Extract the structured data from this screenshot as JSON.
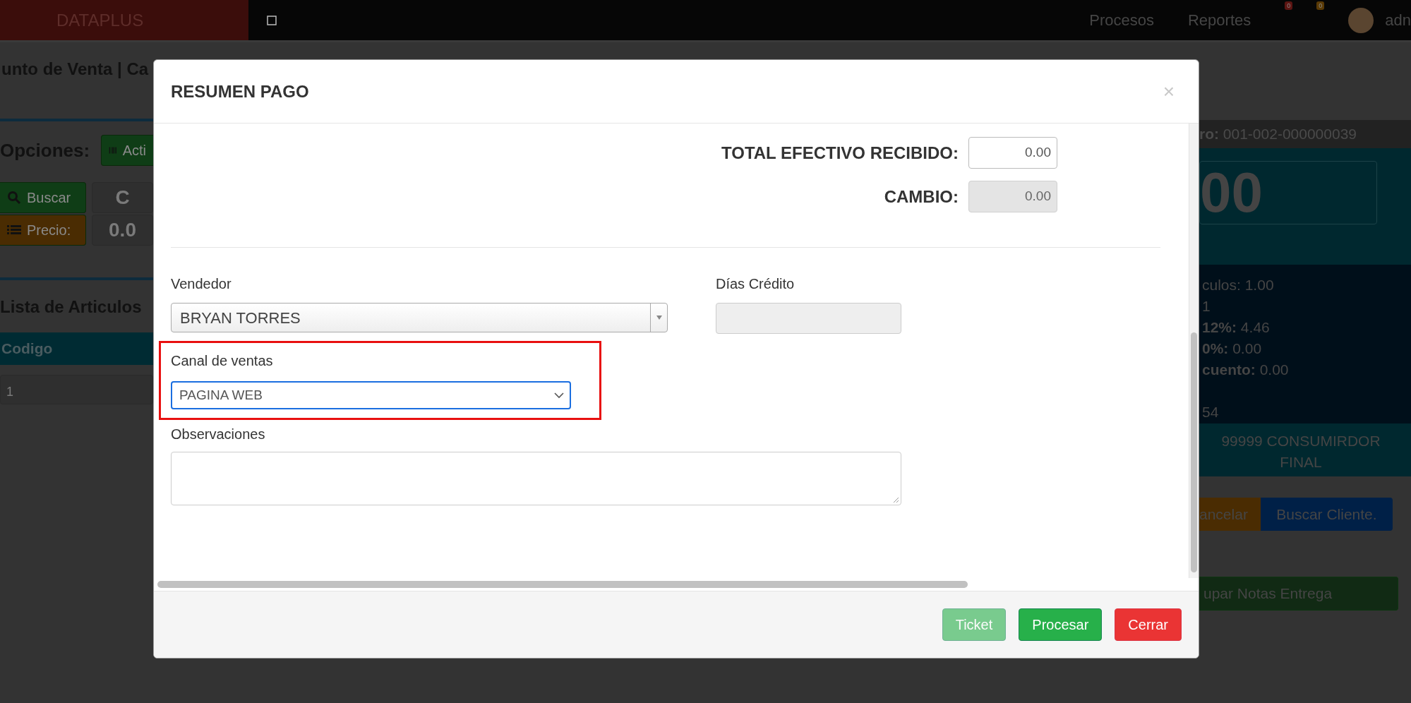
{
  "navbar": {
    "brand": "DATAPLUS",
    "links": [
      {
        "label": "Procesos"
      },
      {
        "label": "Reportes"
      }
    ],
    "badges": [
      {
        "count": "0",
        "color": "#5c1512"
      },
      {
        "count": "0",
        "color": "#5a3a05"
      }
    ],
    "user": "adn"
  },
  "page": {
    "title": "unto de Venta | Ca",
    "options_label": "Opciones:",
    "options_button": "Acti",
    "search_button": "Buscar",
    "search_value": "C",
    "price_button": "Precio:",
    "price_value": "0.0",
    "list_title": "Lista de Articulos",
    "table": {
      "columns": [
        "Codigo"
      ],
      "rows": [
        [
          "1"
        ]
      ]
    }
  },
  "summary": {
    "number_label": "ro:",
    "number": "001-002-000000039",
    "total": "00",
    "lines": [
      {
        "text": "culos: 1.00",
        "gap_before": false
      },
      {
        "text": "1",
        "gap_before": false
      },
      {
        "text": "**12%:** 4.46",
        "gap_before": false
      },
      {
        "text": "**0%:** 0.00",
        "gap_before": false
      },
      {
        "text": "**cuento:** 0.00",
        "gap_before": false
      },
      {
        "text": "54",
        "gap_before": true
      }
    ],
    "client": "99999 CONSUMIRDOR FINAL",
    "buttons": [
      {
        "label": "ancelar",
        "kind": "warning"
      },
      {
        "label": "Buscar Cliente.",
        "kind": "primary"
      }
    ],
    "notes_button": "upar Notas Entrega"
  },
  "modal": {
    "title": "RESUMEN PAGO",
    "close": "×",
    "totals": [
      {
        "label": "TOTAL EFECTIVO RECIBIDO:",
        "value": "0.00",
        "disabled": false
      },
      {
        "label": "CAMBIO:",
        "value": "0.00",
        "disabled": true
      }
    ],
    "vendedor": {
      "label": "Vendedor",
      "value": "BRYAN TORRES"
    },
    "credit_days": {
      "label": "Días Crédito",
      "disabled": true
    },
    "sales_channel": {
      "label": "Canal de ventas",
      "value": "PAGINA WEB",
      "focused": true,
      "highlighted": true
    },
    "notes": {
      "label": "Observaciones"
    },
    "buttons": [
      {
        "label": "Ticket",
        "kind": "success",
        "disabled": true
      },
      {
        "label": "Procesar",
        "kind": "success",
        "disabled": false
      },
      {
        "label": "Cerrar",
        "kind": "danger",
        "disabled": false
      }
    ]
  }
}
